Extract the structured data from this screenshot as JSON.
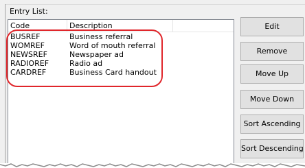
{
  "group": {
    "label": "Entry List:"
  },
  "list": {
    "columns": {
      "code": "Code",
      "description": "Description"
    },
    "rows": [
      {
        "code": "BUSREF",
        "description": "Business referral"
      },
      {
        "code": "WOMREF",
        "description": "Word of mouth referral"
      },
      {
        "code": "NEWSREF",
        "description": "Newspaper ad"
      },
      {
        "code": "RADIOREF",
        "description": "Radio ad"
      },
      {
        "code": "CARDREF",
        "description": "Business Card handout"
      }
    ]
  },
  "buttons": {
    "edit": "Edit",
    "remove": "Remove",
    "move_up": "Move Up",
    "move_down": "Move Down",
    "sort_ascending": "Sort Ascending",
    "sort_descending": "Sort Descending"
  },
  "colors": {
    "highlight": "#e0262b"
  }
}
